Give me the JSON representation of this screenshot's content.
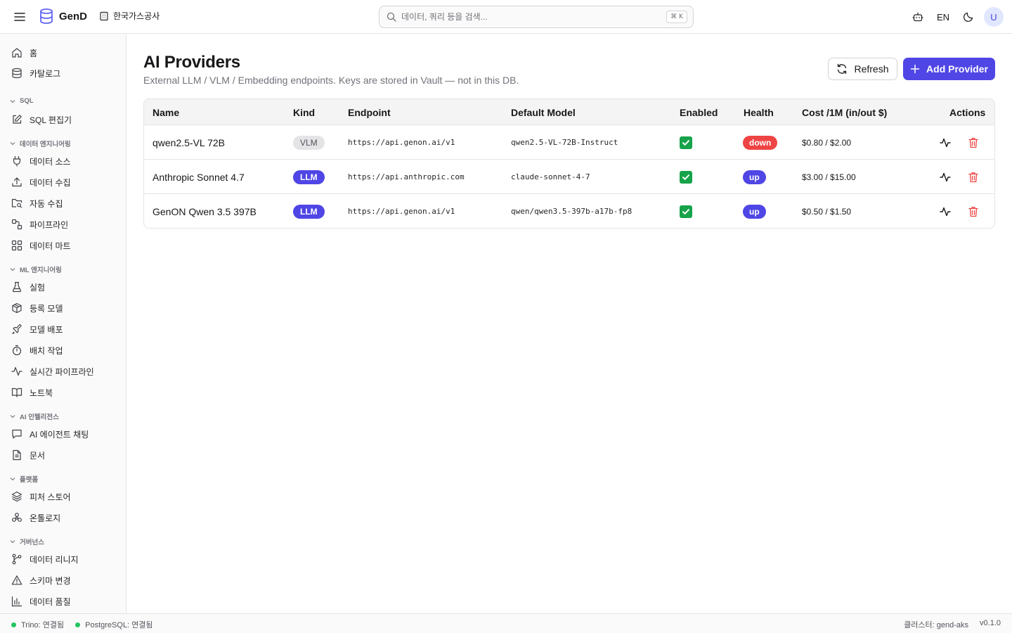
{
  "app": {
    "name": "GenD",
    "org": "한국가스공사"
  },
  "search": {
    "placeholder": "데이터, 쿼리 등을 검색...",
    "shortcut": "⌘ K"
  },
  "topbar": {
    "lang": "EN",
    "avatar": "U"
  },
  "sidebar": {
    "top_items": [
      {
        "label": "홈",
        "icon": "home-icon"
      },
      {
        "label": "카탈로그",
        "icon": "database-icon"
      }
    ],
    "sections": [
      {
        "title": "SQL",
        "items": [
          {
            "label": "SQL 편집기",
            "icon": "edit-icon"
          }
        ]
      },
      {
        "title": "데이터 엔지니어링",
        "items": [
          {
            "label": "데이터 소스",
            "icon": "plug-icon"
          },
          {
            "label": "데이터 수집",
            "icon": "upload-icon"
          },
          {
            "label": "자동 수집",
            "icon": "folder-search-icon"
          },
          {
            "label": "파이프라인",
            "icon": "pipeline-icon"
          },
          {
            "label": "데이터 마트",
            "icon": "grid-icon"
          }
        ]
      },
      {
        "title": "ML 엔지니어링",
        "items": [
          {
            "label": "실험",
            "icon": "flask-icon"
          },
          {
            "label": "등록 모델",
            "icon": "box-icon"
          },
          {
            "label": "모델 배포",
            "icon": "rocket-icon"
          },
          {
            "label": "배치 작업",
            "icon": "timer-icon"
          },
          {
            "label": "실시간 파이프라인",
            "icon": "activity-icon"
          },
          {
            "label": "노트북",
            "icon": "book-icon"
          }
        ]
      },
      {
        "title": "AI 인텔리전스",
        "items": [
          {
            "label": "AI 에이전트 채팅",
            "icon": "chat-icon"
          },
          {
            "label": "문서",
            "icon": "document-icon"
          }
        ]
      },
      {
        "title": "플랫폼",
        "items": [
          {
            "label": "피처 스토어",
            "icon": "layers-icon"
          },
          {
            "label": "온톨로지",
            "icon": "ontology-icon"
          }
        ]
      },
      {
        "title": "거버넌스",
        "items": [
          {
            "label": "데이터 리니지",
            "icon": "lineage-icon"
          },
          {
            "label": "스키마 변경",
            "icon": "warning-icon"
          },
          {
            "label": "데이터 품질",
            "icon": "bar-chart-icon"
          }
        ]
      }
    ]
  },
  "page": {
    "title": "AI Providers",
    "subtitle": "External LLM / VLM / Embedding endpoints. Keys are stored in Vault — not in this DB.",
    "refresh_label": "Refresh",
    "add_label": "Add Provider"
  },
  "table": {
    "headers": [
      "Name",
      "Kind",
      "Endpoint",
      "Default Model",
      "Enabled",
      "Health",
      "Cost /1M (in/out $)",
      "Actions"
    ],
    "rows": [
      {
        "name": "qwen2.5-VL 72B",
        "kind": "VLM",
        "endpoint": "https://api.genon.ai/v1",
        "model": "qwen2.5-VL-72B-Instruct",
        "enabled": true,
        "health": "down",
        "cost": "$0.80 / $2.00"
      },
      {
        "name": "Anthropic Sonnet 4.7",
        "kind": "LLM",
        "endpoint": "https://api.anthropic.com",
        "model": "claude-sonnet-4-7",
        "enabled": true,
        "health": "up",
        "cost": "$3.00 / $15.00"
      },
      {
        "name": "GenON Qwen 3.5 397B",
        "kind": "LLM",
        "endpoint": "https://api.genon.ai/v1",
        "model": "qwen/qwen3.5-397b-a17b-fp8",
        "enabled": true,
        "health": "up",
        "cost": "$0.50 / $1.50"
      }
    ]
  },
  "colors": {
    "accent": "#4f46e5",
    "health_up": "#4f46e5",
    "health_down": "#ef4444",
    "enabled": "#16a34a",
    "status_dot": "#22c55e"
  },
  "footer": {
    "trino": "Trino: 연결됨",
    "postgres": "PostgreSQL: 연결됨",
    "cluster": "클러스터: gend-aks",
    "version": "v0.1.0"
  }
}
